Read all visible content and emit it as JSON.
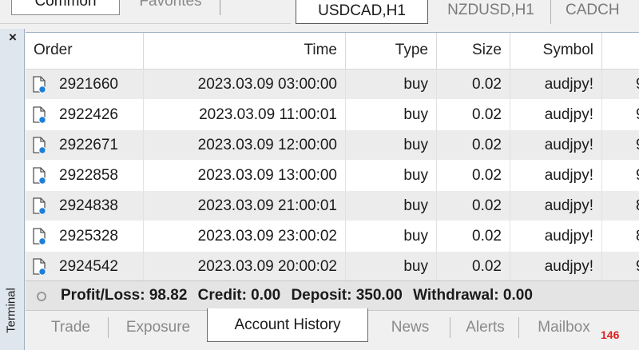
{
  "top_tabs_left": {
    "active": "Common",
    "inactive": "Favorites"
  },
  "chart_tabs": {
    "active": "USDCAD,H1",
    "tab2": "NZDUSD,H1",
    "tab3": "CADCH"
  },
  "sidebar": {
    "close": "×",
    "label": "Terminal"
  },
  "table": {
    "headers": {
      "order": "Order",
      "time": "Time",
      "type": "Type",
      "size": "Size",
      "symbol": "Symbol"
    },
    "rows": [
      {
        "order": "2921660",
        "time": "2023.03.09 03:00:00",
        "type": "buy",
        "size": "0.02",
        "symbol": "audjpy!",
        "extra": "9"
      },
      {
        "order": "2922426",
        "time": "2023.03.09 11:00:01",
        "type": "buy",
        "size": "0.02",
        "symbol": "audjpy!",
        "extra": "9"
      },
      {
        "order": "2922671",
        "time": "2023.03.09 12:00:00",
        "type": "buy",
        "size": "0.02",
        "symbol": "audjpy!",
        "extra": "9"
      },
      {
        "order": "2922858",
        "time": "2023.03.09 13:00:00",
        "type": "buy",
        "size": "0.02",
        "symbol": "audjpy!",
        "extra": "9"
      },
      {
        "order": "2924838",
        "time": "2023.03.09 21:00:01",
        "type": "buy",
        "size": "0.02",
        "symbol": "audjpy!",
        "extra": "8"
      },
      {
        "order": "2925328",
        "time": "2023.03.09 23:00:02",
        "type": "buy",
        "size": "0.02",
        "symbol": "audjpy!",
        "extra": "8"
      },
      {
        "order": "2924542",
        "time": "2023.03.09 20:00:02",
        "type": "buy",
        "size": "0.02",
        "symbol": "audjpy!",
        "extra": "9"
      }
    ]
  },
  "summary": {
    "profit_loss": "Profit/Loss: 98.82",
    "credit": "Credit: 0.00",
    "deposit": "Deposit: 350.00",
    "withdrawal": "Withdrawal: 0.00"
  },
  "bottom_tabs": {
    "trade": "Trade",
    "exposure": "Exposure",
    "account_history": "Account History",
    "news": "News",
    "alerts": "Alerts",
    "mailbox": "Mailbox",
    "mailbox_count": "146"
  },
  "colors": {
    "badge": "#e02020",
    "icon_blue": "#1e7fd8",
    "row_alt": "#ececec"
  }
}
